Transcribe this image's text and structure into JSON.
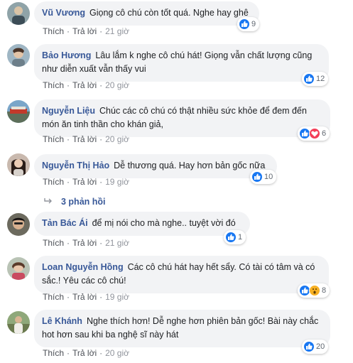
{
  "action_like": "Thích",
  "action_reply": "Trả lời",
  "separator": "·",
  "comments": [
    {
      "author": "Vũ Vương",
      "text": "Giọng cô chú còn tốt quá. Nghe hay ghê",
      "time": "21 giờ",
      "reaction_count": "9",
      "reactions": [
        "like"
      ]
    },
    {
      "author": "Bảo Hương",
      "text": "Lâu lắm k nghe cô chú hát! Giọng vẫn chất lượng cũng như diễn xuất vẫn thấy vui",
      "time": "20 giờ",
      "reaction_count": "12",
      "reactions": [
        "like"
      ]
    },
    {
      "author": "Nguyễn Liệu",
      "text": "Chúc các cô chú có thật nhiều sức khỏe để đem đến món ăn tinh thần cho khán giả,",
      "time": "20 giờ",
      "reaction_count": "6",
      "reactions": [
        "like",
        "love"
      ]
    },
    {
      "author": "Nguyễn Thị Hảo",
      "text": "Dễ thương quá. Hay hơn bản gốc nữa",
      "time": "19 giờ",
      "reaction_count": "10",
      "reactions": [
        "like"
      ]
    },
    {
      "author": "Tản Bác Ái",
      "text": "để mị nói cho mà nghe.. tuyệt vời đó",
      "time": "21 giờ",
      "reaction_count": "1",
      "reactions": [
        "like"
      ]
    },
    {
      "author": "Loan Nguyễn Hồng",
      "text": "Các cô chú hát hay hết sẩy. Có tài có tâm và có sắc.! Yêu các cô chú!",
      "time": "19 giờ",
      "reaction_count": "8",
      "reactions": [
        "like",
        "wow"
      ]
    },
    {
      "author": "Lê Khánh",
      "text": "Nghe thích hơn! Dễ nghe hơn phiên bản gốc! Bài này chắc hot hơn sau khi ba nghệ sĩ này hát",
      "time": "20 giờ",
      "reaction_count": "20",
      "reactions": [
        "like"
      ]
    }
  ],
  "view_replies": "3 phản hồi",
  "colors": {
    "link": "#385898",
    "bubble": "#f2f3f5",
    "like": "#1877f2",
    "love": "#f33e58",
    "wow": "#f7b125"
  },
  "icons": {
    "like": "thumbs-up-icon",
    "love": "heart-icon",
    "wow": "wow-face-icon",
    "replies_arrow": "reply-arrow-icon"
  }
}
